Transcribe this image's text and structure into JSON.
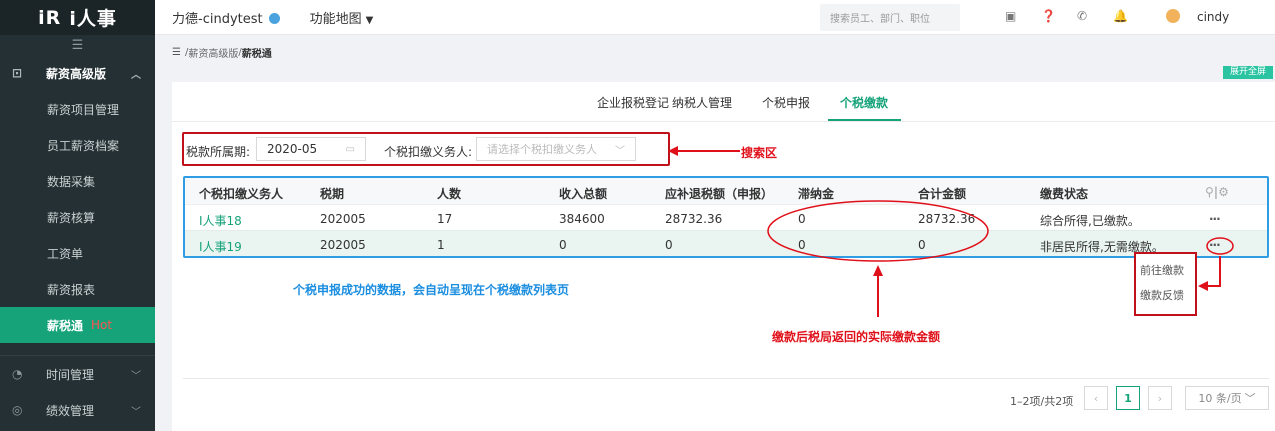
{
  "logo": {
    "mark": "iR",
    "text": "i人事"
  },
  "sidebar": {
    "menu_icon": "☰",
    "group1": {
      "label": "薪资高级版",
      "icon": "folder-icon"
    },
    "items": [
      {
        "label": "薪资项目管理"
      },
      {
        "label": "员工薪资档案"
      },
      {
        "label": "数据采集"
      },
      {
        "label": "薪资核算"
      },
      {
        "label": "工资单"
      },
      {
        "label": "薪资报表"
      },
      {
        "label": "薪税通",
        "badge": "Hot"
      }
    ],
    "group2": {
      "label": "时间管理",
      "icon": "clock-icon"
    },
    "group3": {
      "label": "绩效管理",
      "icon": "target-icon"
    }
  },
  "topbar": {
    "company": "力德-cindytest",
    "funcmap": "功能地图",
    "search_placeholder": "搜索员工、部门、职位",
    "user": "cindy"
  },
  "breadcrumb": {
    "sep": " / ",
    "level1": "薪资高级版",
    "level2": "薪税通"
  },
  "fullscreen": "展开全屏",
  "tabs": [
    "企业报税登记",
    "纳税人管理",
    "个税申报",
    "个税缴款"
  ],
  "search": {
    "period_label": "税款所属期:",
    "period_value": "2020-05",
    "agent_label": "个税扣缴义务人:",
    "agent_placeholder": "请选择个税扣缴义务人"
  },
  "table": {
    "headers": [
      "个税扣缴义务人",
      "税期",
      "人数",
      "收入总额",
      "应补退税额（申报）",
      "滞纳金",
      "合计金额",
      "缴费状态"
    ],
    "rows": [
      [
        "I人事18",
        "202005",
        "17",
        "384600",
        "28732.36",
        "0",
        "28732.36",
        "综合所得,已缴款。"
      ],
      [
        "I人事19",
        "202005",
        "1",
        "0",
        "0",
        "0",
        "0",
        "非居民所得,无需缴款。"
      ]
    ],
    "more": "···"
  },
  "popup": {
    "items": [
      "前往缴款",
      "缴款反馈"
    ]
  },
  "annotations": {
    "search_area": "搜索区",
    "auto_list": "个税申报成功的数据，会自动呈现在个税缴款列表页",
    "actual_amount": "缴款后税局返回的实际缴款金额"
  },
  "pagination": {
    "summary": "1–2项/共2项",
    "current": "1",
    "page_size": "10 条/页"
  },
  "colors": {
    "accent": "#17a37a",
    "sidebar": "#243033",
    "annotation_red": "#e0101a",
    "annotation_blue": "#1b8ee0"
  }
}
